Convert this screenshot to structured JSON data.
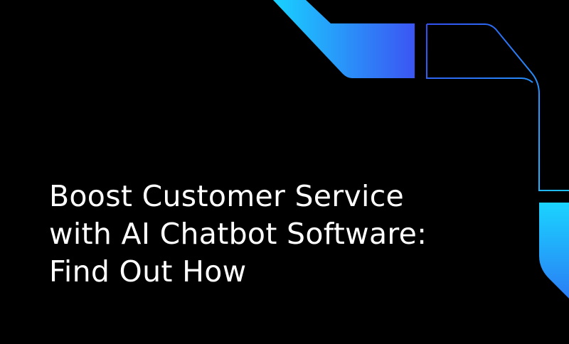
{
  "headline": {
    "line1": "Boost Customer Service",
    "line2": "with AI Chatbot Software:",
    "line3": "Find Out How"
  },
  "colors": {
    "background": "#000000",
    "text": "#ffffff",
    "gradient_cyan": "#19c8ff",
    "gradient_blue": "#3a55f2",
    "outline_blue": "#2f55f0",
    "outline_cyan": "#22b8ff"
  },
  "decorations": {
    "shape_top": "gradient-bracket-shape",
    "shape_outline": "outline-bracket-shape",
    "shape_right": "gradient-corner-shape"
  }
}
